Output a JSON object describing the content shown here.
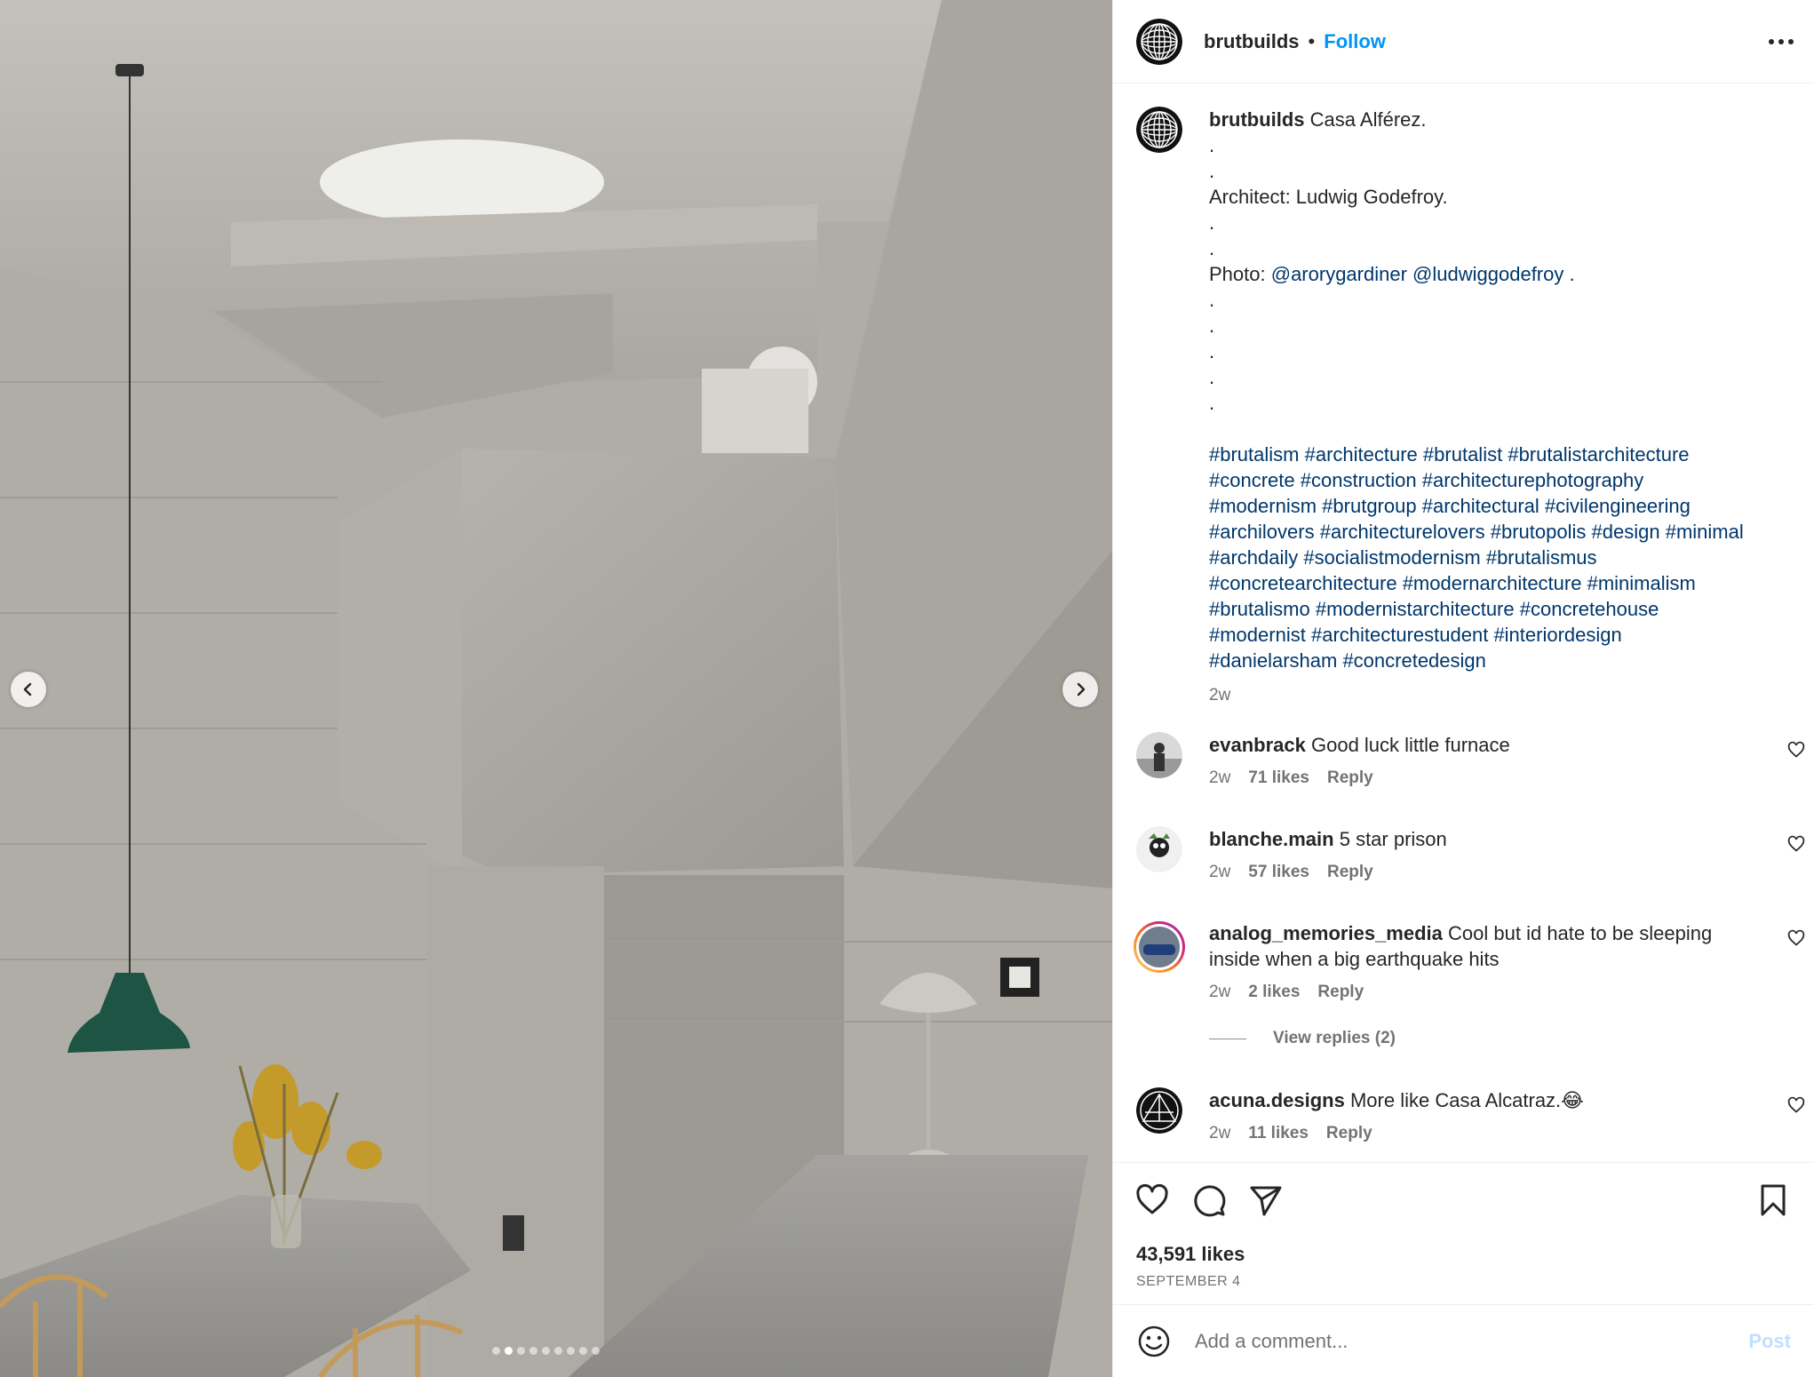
{
  "header": {
    "username": "brutbuilds",
    "separator": "•",
    "follow_label": "Follow"
  },
  "caption": {
    "username": "brutbuilds",
    "title": "Casa Alférez.",
    "architect_line": "Architect: Ludwig Godefroy.",
    "photo_label": "Photo:",
    "mentions": [
      "@arorygardiner",
      "@ludwiggodefroy"
    ],
    "dot": ".",
    "hashtag_lines": [
      "#brutalism #architecture #brutalist #brutalistarchitecture",
      "#concrete #construction #architecturephotography",
      "#modernism #brutgroup #architectural #civilengineering",
      "#archilovers #architecturelovers #brutopolis #design #minimal",
      "#archdaily #socialistmodernism #brutalismus",
      "#concretearchitecture #modernarchitecture #minimalism",
      "#brutalismo #modernistarchitecture #concretehouse",
      "#modernist #architecturestudent #interiordesign",
      "#danielarsham #concretedesign"
    ],
    "time": "2w"
  },
  "comments": [
    {
      "username": "evanbrack",
      "text": "Good luck little furnace",
      "time": "2w",
      "likes": "71 likes",
      "reply": "Reply"
    },
    {
      "username": "blanche.main",
      "text": "5 star prison",
      "time": "2w",
      "likes": "57 likes",
      "reply": "Reply"
    },
    {
      "username": "analog_memories_media",
      "text": "Cool but id hate to be sleeping inside when a big earthquake hits",
      "time": "2w",
      "likes": "2 likes",
      "reply": "Reply"
    },
    {
      "username": "acuna.designs",
      "text": "More like Casa Alcatraz.😂",
      "time": "2w",
      "likes": "11 likes",
      "reply": "Reply"
    }
  ],
  "view_replies": "View replies (2)",
  "post": {
    "likes": "43,591 likes",
    "date": "SEPTEMBER 4"
  },
  "comment_box": {
    "placeholder": "Add a comment...",
    "post_label": "Post"
  },
  "carousel": {
    "slide_count": 9,
    "active_index": 1
  },
  "colors": {
    "link": "#00376b",
    "follow": "#0095f6",
    "muted": "#737373",
    "post_disabled": "#c0dffd"
  }
}
